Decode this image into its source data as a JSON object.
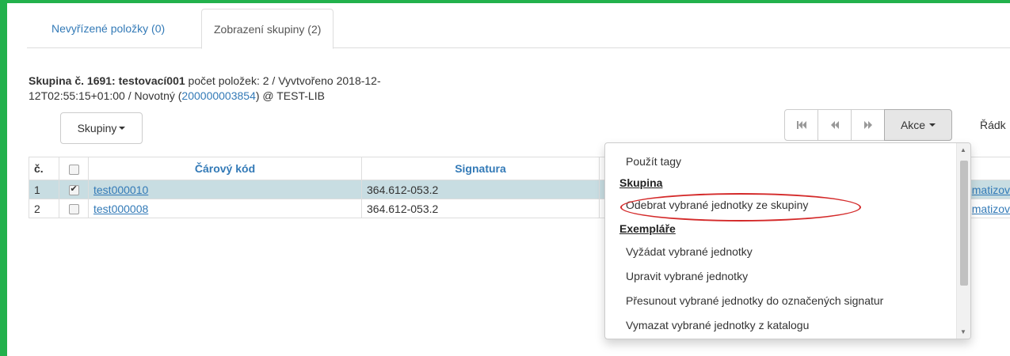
{
  "tabs": [
    {
      "label": "Nevyřízené položky (0)",
      "active": false
    },
    {
      "label": "Zobrazení skupiny (2)",
      "active": true
    }
  ],
  "group_info": {
    "title": "Skupina č. 1691: testovací001",
    "count_text": " počet položek: 2 / Vyvtvořeno 2018-12-",
    "line2_prefix": "12T02:55:15+01:00 / Novotný (",
    "user_id": "200000003854",
    "line2_suffix": ") @ TEST-LIB"
  },
  "groups_button": {
    "label": "Skupiny"
  },
  "pagination": {
    "first_icon": "first-page-icon",
    "prev_icon": "prev-page-icon",
    "next_icon": "next-page-icon",
    "actions_label": "Akce",
    "rows_label": "Řádk"
  },
  "table": {
    "headers": {
      "num": "č.",
      "barcode": "Čárový kód",
      "signature": "Signatura"
    },
    "rows": [
      {
        "num": "1",
        "checked": true,
        "barcode": "test000010",
        "signature": "364.612-053.2",
        "tail": "matizov"
      },
      {
        "num": "2",
        "checked": false,
        "barcode": "test000008",
        "signature": "364.612-053.2",
        "tail": "matizov"
      }
    ]
  },
  "actions_menu": {
    "use_tags": "Použít tagy",
    "group_header": "Skupina",
    "remove_from_group": "Odebrat vybrané jednotky ze skupiny",
    "items_header": "Exempláře",
    "request_items": "Vyžádat vybrané jednotky",
    "edit_items": "Upravit vybrané jednotky",
    "move_items": "Přesunout vybrané jednotky do označených signatur",
    "delete_items": "Vymazat vybrané jednotky z katalogu"
  },
  "colors": {
    "frame": "#22b14c",
    "link": "#337ab7",
    "selected_row": "#c8dde2",
    "highlight": "#d42a2a"
  }
}
